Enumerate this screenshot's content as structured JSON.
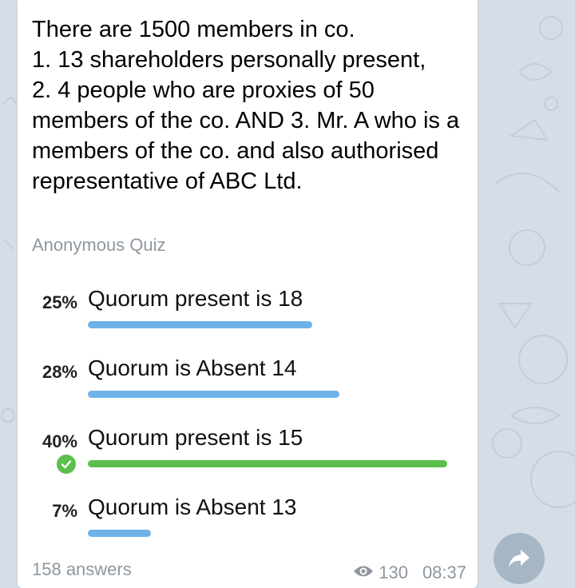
{
  "poll": {
    "question": "There are 1500 members in co.\n1. 13 shareholders personally present,\n2. 4 people who are proxies of 50 members of the co. AND  3. Mr. A who is a members of the co. and also authorised representative of ABC Ltd.",
    "type_label": "Anonymous Quiz",
    "options": [
      {
        "percent": "25%",
        "text": "Quorum present is 18",
        "fraction": 0.25,
        "correct": false
      },
      {
        "percent": "28%",
        "text": "Quorum is Absent 14",
        "fraction": 0.28,
        "correct": false
      },
      {
        "percent": "40%",
        "text": "Quorum present is 15",
        "fraction": 0.4,
        "correct": true
      },
      {
        "percent": "7%",
        "text": "Quorum is Absent 13",
        "fraction": 0.07,
        "correct": false
      }
    ],
    "answers_label": "158 answers",
    "views": "130",
    "time": "08:37"
  },
  "icons": {
    "check": "check-icon",
    "views": "eye-icon",
    "share": "share-arrow-icon"
  },
  "colors": {
    "bar": "#6fb2e8",
    "correct": "#5cbf4c",
    "background": "#d5dee6",
    "muted_text": "#8e979f"
  }
}
